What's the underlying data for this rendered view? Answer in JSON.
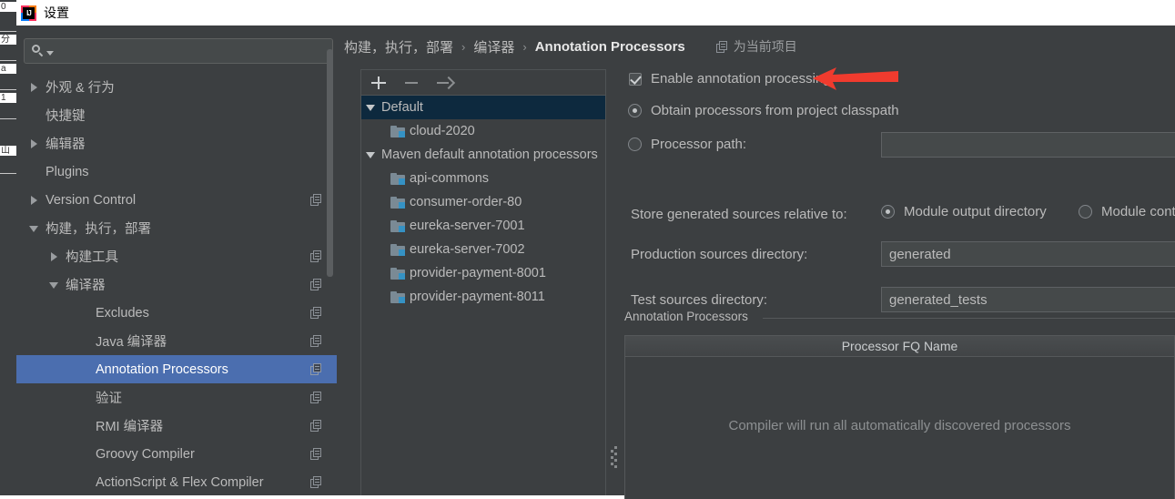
{
  "window": {
    "title": "设置",
    "app_icon": "intellij-idea-logo"
  },
  "background_strip": {
    "lines": [
      "0",
      "分",
      "a",
      "1",
      "山"
    ]
  },
  "sidebar": {
    "search": {
      "value": "",
      "placeholder": "",
      "icon": "search-icon"
    },
    "items": [
      {
        "label": "外观 & 行为",
        "arrow": "right",
        "indent": 0,
        "copy": false,
        "selected": false
      },
      {
        "label": "快捷键",
        "arrow": "none",
        "indent": 0,
        "copy": false,
        "selected": false
      },
      {
        "label": "编辑器",
        "arrow": "right",
        "indent": 0,
        "copy": false,
        "selected": false
      },
      {
        "label": "Plugins",
        "arrow": "none",
        "indent": 0,
        "copy": false,
        "selected": false
      },
      {
        "label": "Version Control",
        "arrow": "right",
        "indent": 0,
        "copy": true,
        "selected": false
      },
      {
        "label": "构建，执行，部署",
        "arrow": "down",
        "indent": 0,
        "copy": false,
        "selected": false
      },
      {
        "label": "构建工具",
        "arrow": "right",
        "indent": 1,
        "copy": true,
        "selected": false
      },
      {
        "label": "编译器",
        "arrow": "down",
        "indent": 1,
        "copy": true,
        "selected": false
      },
      {
        "label": "Excludes",
        "arrow": "none",
        "indent": 2,
        "copy": true,
        "selected": false
      },
      {
        "label": "Java 编译器",
        "arrow": "none",
        "indent": 2,
        "copy": true,
        "selected": false
      },
      {
        "label": "Annotation Processors",
        "arrow": "none",
        "indent": 2,
        "copy": true,
        "selected": true
      },
      {
        "label": "验证",
        "arrow": "none",
        "indent": 2,
        "copy": true,
        "selected": false
      },
      {
        "label": "RMI 编译器",
        "arrow": "none",
        "indent": 2,
        "copy": true,
        "selected": false
      },
      {
        "label": "Groovy Compiler",
        "arrow": "none",
        "indent": 2,
        "copy": true,
        "selected": false
      },
      {
        "label": "ActionScript & Flex Compiler",
        "arrow": "none",
        "indent": 2,
        "copy": true,
        "selected": false
      }
    ]
  },
  "breadcrumb": {
    "crumbs": [
      "构建，执行，部署",
      "编译器",
      "Annotation Processors"
    ],
    "separator": "›",
    "project_scope_label": "为当前项目",
    "project_scope_icon": "copy-icon"
  },
  "modules_panel": {
    "toolbar": [
      {
        "name": "add-profile-button",
        "icon": "plus-icon",
        "enabled": true
      },
      {
        "name": "remove-profile-button",
        "icon": "minus-icon",
        "enabled": false
      },
      {
        "name": "move-to-profile-button",
        "icon": "arrow-right-icon",
        "enabled": false
      }
    ],
    "nodes": [
      {
        "label": "Default",
        "type": "group",
        "arrow": "down",
        "selected": true
      },
      {
        "label": "cloud-2020",
        "type": "module",
        "arrow": "none",
        "selected": false
      },
      {
        "label": "Maven default annotation processors",
        "type": "group",
        "arrow": "down",
        "selected": false
      },
      {
        "label": "api-commons",
        "type": "module",
        "arrow": "none",
        "selected": false
      },
      {
        "label": "consumer-order-80",
        "type": "module",
        "arrow": "none",
        "selected": false
      },
      {
        "label": "eureka-server-7001",
        "type": "module",
        "arrow": "none",
        "selected": false
      },
      {
        "label": "eureka-server-7002",
        "type": "module",
        "arrow": "none",
        "selected": false
      },
      {
        "label": "provider-payment-8001",
        "type": "module",
        "arrow": "none",
        "selected": false
      },
      {
        "label": "provider-payment-8011",
        "type": "module",
        "arrow": "none",
        "selected": false
      }
    ]
  },
  "settings": {
    "enable_annotation_processing": {
      "label": "Enable annotation processing",
      "checked": true
    },
    "source_mode": {
      "options": [
        {
          "label": "Obtain processors from project classpath",
          "selected": true
        },
        {
          "label": "Processor path:",
          "selected": false
        }
      ],
      "processor_path_value": ""
    },
    "store_relative_label": "Store generated sources relative to:",
    "store_relative_options": [
      {
        "label": "Module output directory",
        "selected": true
      },
      {
        "label": "Module content root",
        "selected": false
      }
    ],
    "production_sources": {
      "label": "Production sources directory:",
      "value": "generated"
    },
    "test_sources": {
      "label": "Test sources directory:",
      "value": "generated_tests"
    },
    "annotation_processors_group": {
      "title": "Annotation Processors",
      "column_header": "Processor FQ Name",
      "empty_message": "Compiler will run all automatically discovered processors"
    }
  },
  "annotation": {
    "arrow_color": "#f03b2e",
    "points_at": "Enable annotation processing"
  },
  "colors": {
    "dialog_bg": "#3c3f41",
    "selection_blue": "#4b6eaf",
    "tree_selection_navy": "#0d293e",
    "text": "#bbbbbb",
    "field_bg": "#45494a"
  }
}
